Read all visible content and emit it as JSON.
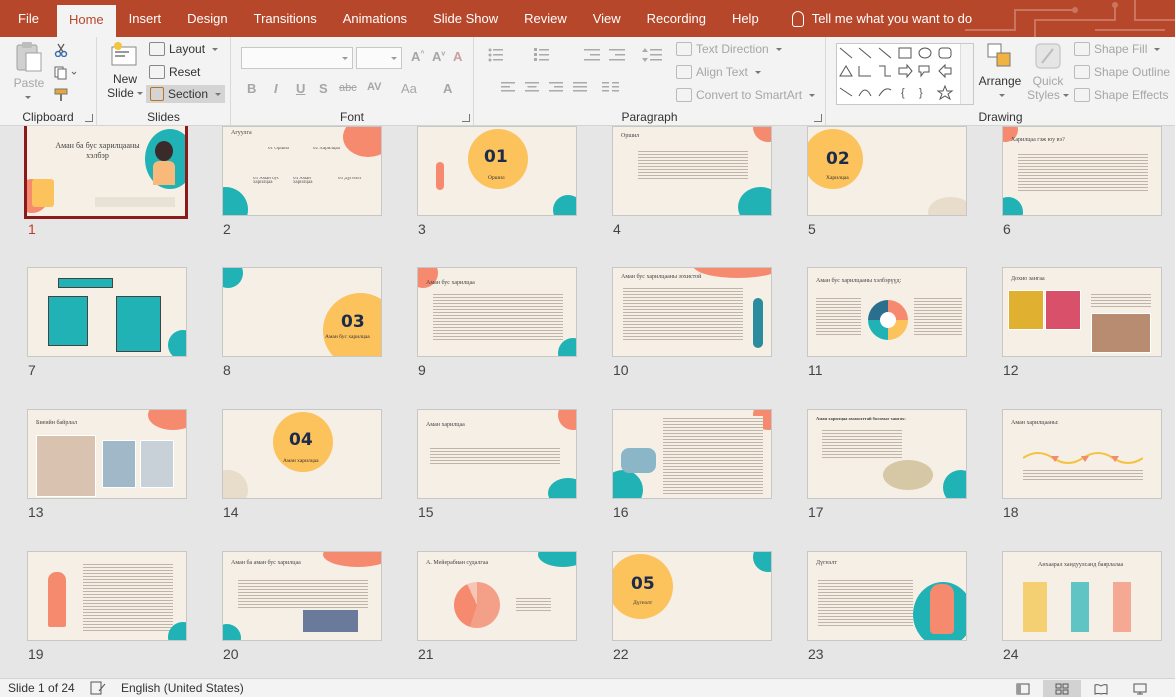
{
  "tabs": [
    "File",
    "Home",
    "Insert",
    "Design",
    "Transitions",
    "Animations",
    "Slide Show",
    "Review",
    "View",
    "Recording",
    "Help"
  ],
  "tell_me": "Tell me what you want to do",
  "clipboard": {
    "paste": "Paste",
    "label": "Clipboard"
  },
  "slides_group": {
    "new_slide_1": "New",
    "new_slide_2": "Slide",
    "layout": "Layout",
    "reset": "Reset",
    "section": "Section",
    "label": "Slides"
  },
  "font_group": {
    "label": "Font",
    "bold": "B",
    "italic": "I",
    "underline": "U",
    "shadow": "S",
    "strike": "abc",
    "case": "Aa"
  },
  "paragraph_group": {
    "label": "Paragraph",
    "text_direction": "Text Direction",
    "align_text": "Align Text",
    "convert_smartart": "Convert to SmartArt"
  },
  "drawing_group": {
    "label": "Drawing",
    "arrange": "Arrange",
    "quick_styles_1": "Quick",
    "quick_styles_2": "Styles",
    "shape_fill": "Shape Fill",
    "shape_outline": "Shape Outline",
    "shape_effects": "Shape Effects"
  },
  "slides": [
    {
      "n": "1"
    },
    {
      "n": "2"
    },
    {
      "n": "3"
    },
    {
      "n": "4"
    },
    {
      "n": "5"
    },
    {
      "n": "6"
    },
    {
      "n": "7"
    },
    {
      "n": "8"
    },
    {
      "n": "9"
    },
    {
      "n": "10"
    },
    {
      "n": "11"
    },
    {
      "n": "12"
    },
    {
      "n": "13"
    },
    {
      "n": "14"
    },
    {
      "n": "15"
    },
    {
      "n": "16"
    },
    {
      "n": "17"
    },
    {
      "n": "18"
    },
    {
      "n": "19"
    },
    {
      "n": "20"
    },
    {
      "n": "21"
    },
    {
      "n": "22"
    },
    {
      "n": "23"
    },
    {
      "n": "24"
    }
  ],
  "slide_content": {
    "s1_title": "Аман ба бус харилцааны хэлбэр",
    "s2_title": "Агуулга",
    "s2_items": [
      "01 Оршил",
      "02 Харилцаа",
      "03 Аман бус харилцаа",
      "04 Аман харилцаа",
      "05 Дүгнэлт"
    ],
    "s3_num": "01",
    "s3_sub": "Оршил",
    "s4_title": "Оршил",
    "s5_num": "02",
    "s5_sub": "Харилцаа",
    "s6_title": "Харилцаа гэж юу вэ?",
    "s8_num": "03",
    "s8_sub": "Аман бус харилцаа",
    "s9_title": "Аман бус харилцаа",
    "s10_title": "Аман бус харилцааны зохистой",
    "s11_title": "Аман бус харилцааны хэлбэрүүд:",
    "s12_title": "Дохио зангаа",
    "s13_title": "Биеийн байрлал",
    "s14_num": "04",
    "s14_sub": "Аман харилцаа",
    "s15_title": "Аман харилцаа",
    "s17_title": "Аман харилцаа амжилттай болохыг хангах:",
    "s18_title": "Аман харилцааны:",
    "s20_title": "Аман ба аман бус харилцаа",
    "s21_title": "А. Мейерабиан судалгаа",
    "s22_num": "05",
    "s22_sub": "Дүгнэлт",
    "s23_title": "Дүгнэлт",
    "s24_title": "Анхаарал хандуулсанд баярлалаа"
  },
  "status": {
    "slide_info": "Slide 1 of 24",
    "language": "English (United States)"
  },
  "colors": {
    "accent": "#b7472a",
    "coral": "#f58a6f",
    "teal": "#20b2b5",
    "yellow": "#fcc25c",
    "cream": "#f6efe6"
  }
}
